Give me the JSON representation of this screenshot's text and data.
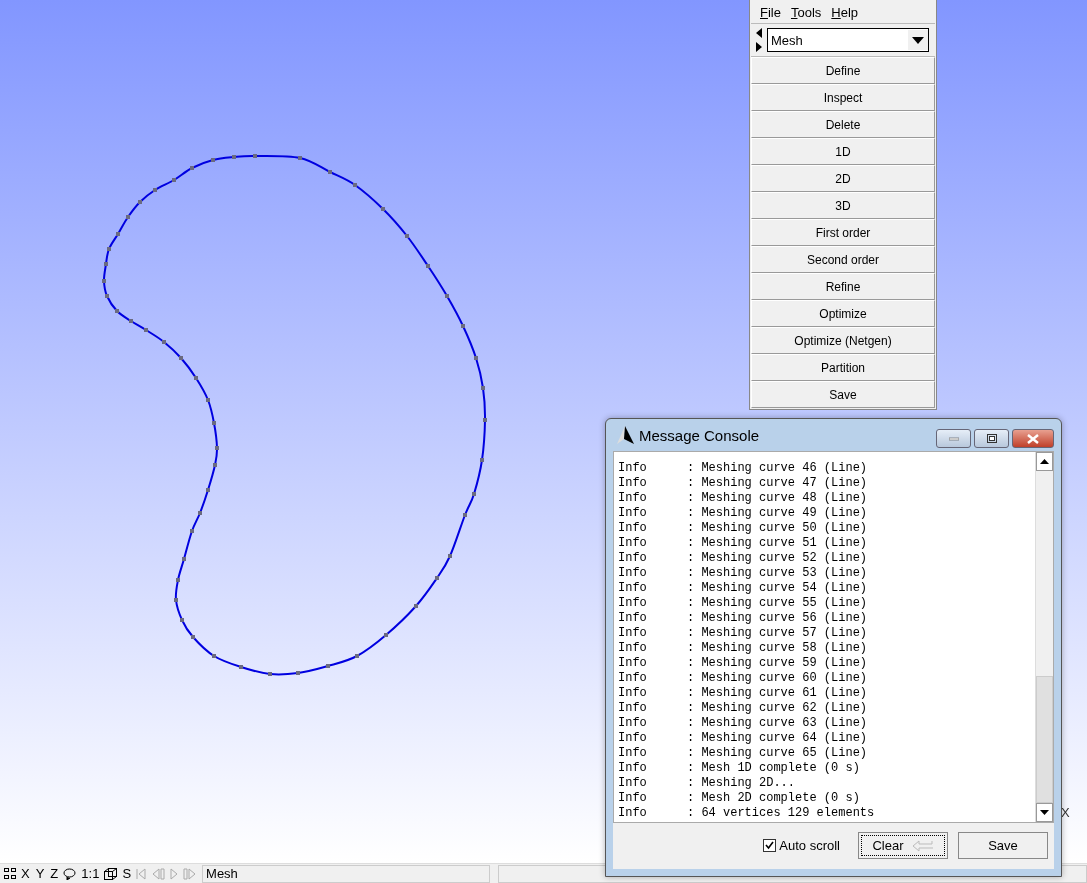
{
  "menu_panel": {
    "menubar": [
      {
        "label": "File"
      },
      {
        "label": "Tools"
      },
      {
        "label": "Help"
      }
    ],
    "module": {
      "value": "Mesh"
    },
    "buttons": [
      {
        "label": "Define"
      },
      {
        "label": "Inspect"
      },
      {
        "label": "Delete"
      },
      {
        "label": "1D"
      },
      {
        "label": "2D"
      },
      {
        "label": "3D"
      },
      {
        "label": "First order"
      },
      {
        "label": "Second order"
      },
      {
        "label": "Refine"
      },
      {
        "label": "Optimize"
      },
      {
        "label": "Optimize (Netgen)"
      },
      {
        "label": "Partition"
      },
      {
        "label": "Save"
      }
    ]
  },
  "console": {
    "title": "Message Console",
    "lines": [
      {
        "level": "Info",
        "text": ": Meshing curve 46 (Line)"
      },
      {
        "level": "Info",
        "text": ": Meshing curve 47 (Line)"
      },
      {
        "level": "Info",
        "text": ": Meshing curve 48 (Line)"
      },
      {
        "level": "Info",
        "text": ": Meshing curve 49 (Line)"
      },
      {
        "level": "Info",
        "text": ": Meshing curve 50 (Line)"
      },
      {
        "level": "Info",
        "text": ": Meshing curve 51 (Line)"
      },
      {
        "level": "Info",
        "text": ": Meshing curve 52 (Line)"
      },
      {
        "level": "Info",
        "text": ": Meshing curve 53 (Line)"
      },
      {
        "level": "Info",
        "text": ": Meshing curve 54 (Line)"
      },
      {
        "level": "Info",
        "text": ": Meshing curve 55 (Line)"
      },
      {
        "level": "Info",
        "text": ": Meshing curve 56 (Line)"
      },
      {
        "level": "Info",
        "text": ": Meshing curve 57 (Line)"
      },
      {
        "level": "Info",
        "text": ": Meshing curve 58 (Line)"
      },
      {
        "level": "Info",
        "text": ": Meshing curve 59 (Line)"
      },
      {
        "level": "Info",
        "text": ": Meshing curve 60 (Line)"
      },
      {
        "level": "Info",
        "text": ": Meshing curve 61 (Line)"
      },
      {
        "level": "Info",
        "text": ": Meshing curve 62 (Line)"
      },
      {
        "level": "Info",
        "text": ": Meshing curve 63 (Line)"
      },
      {
        "level": "Info",
        "text": ": Meshing curve 64 (Line)"
      },
      {
        "level": "Info",
        "text": ": Meshing curve 65 (Line)"
      },
      {
        "level": "Info",
        "text": ": Mesh 1D complete (0 s)"
      },
      {
        "level": "Info",
        "text": ": Meshing 2D..."
      },
      {
        "level": "Info",
        "text": ": Mesh 2D complete (0 s)"
      },
      {
        "level": "Info",
        "text": ": 64 vertices 129 elements"
      }
    ],
    "auto_scroll": {
      "label": "Auto scroll",
      "checked": true
    },
    "clear_button": "Clear",
    "save_button": "Save"
  },
  "axis_label": "X",
  "status_bar": {
    "buttons": [
      "X",
      "Y",
      "Z",
      "1:1",
      "S"
    ],
    "message": "Mesh"
  }
}
